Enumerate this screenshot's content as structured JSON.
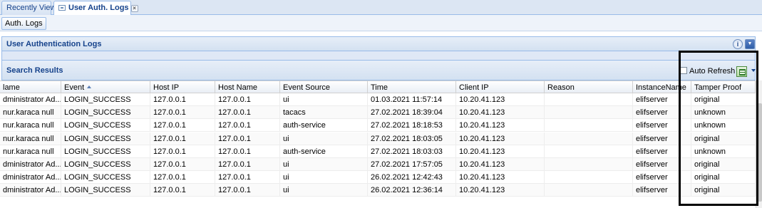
{
  "tabs": [
    {
      "label": "Recently View"
    },
    {
      "label": "User Auth. Logs"
    }
  ],
  "close_glyph": "×",
  "subtab": {
    "label": "Auth. Logs"
  },
  "panel": {
    "title": "User Authentication Logs",
    "info_glyph": "i",
    "collapse_glyph": "▼"
  },
  "results": {
    "title": "Search Results",
    "auto_refresh_label": "Auto Refresh",
    "auto_refresh_checked": false,
    "sorted_column": "Event",
    "sort_direction": "ascending"
  },
  "grid": {
    "columns": [
      "lame",
      "Event",
      "Host IP",
      "Host Name",
      "Event Source",
      "Time",
      "Client IP",
      "Reason",
      "InstanceName",
      "Tamper Proof"
    ],
    "rows": [
      [
        "dministrator Ad...",
        "LOGIN_SUCCESS",
        "127.0.0.1",
        "127.0.0.1",
        "ui",
        "01.03.2021 11:57:14",
        "10.20.41.123",
        "",
        "elifserver",
        "original"
      ],
      [
        "nur.karaca null",
        "LOGIN_SUCCESS",
        "127.0.0.1",
        "127.0.0.1",
        "tacacs",
        "27.02.2021 18:39:04",
        "10.20.41.123",
        "",
        "elifserver",
        "unknown"
      ],
      [
        "nur.karaca null",
        "LOGIN_SUCCESS",
        "127.0.0.1",
        "127.0.0.1",
        "auth-service",
        "27.02.2021 18:18:53",
        "10.20.41.123",
        "",
        "elifserver",
        "unknown"
      ],
      [
        "nur.karaca null",
        "LOGIN_SUCCESS",
        "127.0.0.1",
        "127.0.0.1",
        "ui",
        "27.02.2021 18:03:05",
        "10.20.41.123",
        "",
        "elifserver",
        "original"
      ],
      [
        "nur.karaca null",
        "LOGIN_SUCCESS",
        "127.0.0.1",
        "127.0.0.1",
        "auth-service",
        "27.02.2021 18:03:03",
        "10.20.41.123",
        "",
        "elifserver",
        "unknown"
      ],
      [
        "dministrator Ad...",
        "LOGIN_SUCCESS",
        "127.0.0.1",
        "127.0.0.1",
        "ui",
        "27.02.2021 17:57:05",
        "10.20.41.123",
        "",
        "elifserver",
        "original"
      ],
      [
        "dministrator Ad...",
        "LOGIN_SUCCESS",
        "127.0.0.1",
        "127.0.0.1",
        "ui",
        "26.02.2021 12:42:43",
        "10.20.41.123",
        "",
        "elifserver",
        "original"
      ],
      [
        "dministrator Ad...",
        "LOGIN_SUCCESS",
        "127.0.0.1",
        "127.0.0.1",
        "ui",
        "26.02.2021 12:36:14",
        "10.20.41.123",
        "",
        "elifserver",
        "original"
      ]
    ]
  },
  "icons": {
    "tab_icon": "window-icon",
    "info": "info-icon",
    "collapse": "chevron-down-icon",
    "export": "excel-export-icon"
  },
  "colors": {
    "header_text": "#15428b",
    "panel_border": "#99bbe8",
    "highlight_border": "#000000"
  }
}
